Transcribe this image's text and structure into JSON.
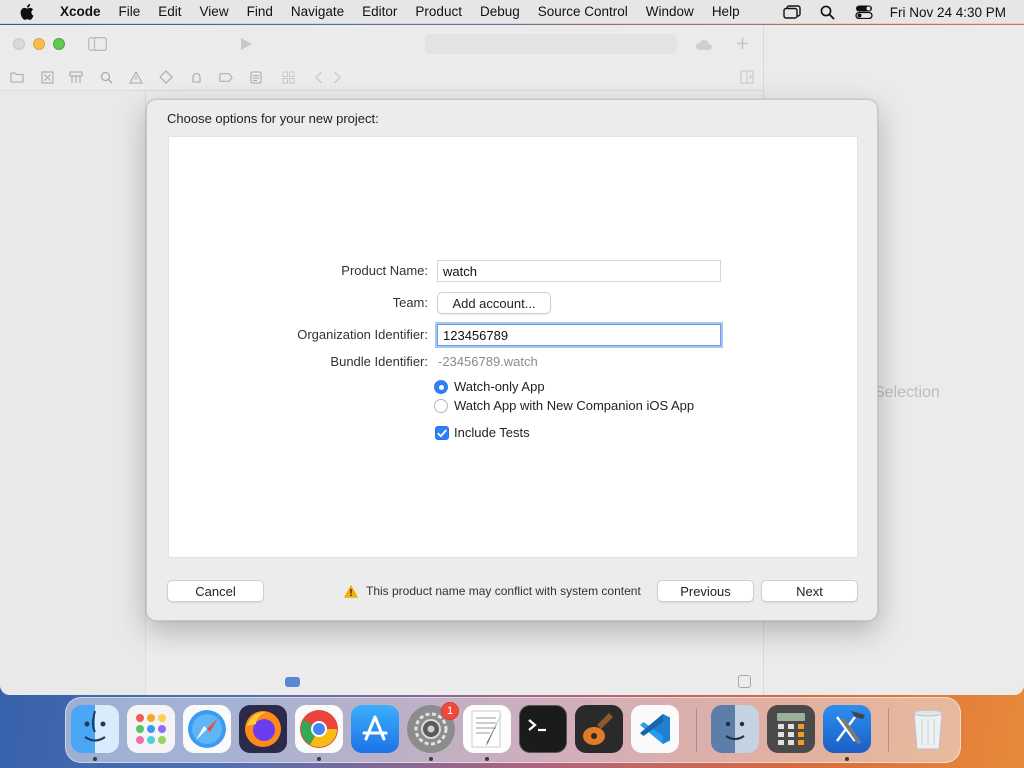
{
  "menubar": {
    "app_name": "Xcode",
    "items": [
      "File",
      "Edit",
      "View",
      "Find",
      "Navigate",
      "Editor",
      "Product",
      "Debug",
      "Source Control",
      "Window",
      "Help"
    ],
    "clock": "Fri Nov 24  4:30 PM"
  },
  "window": {
    "inspector_placeholder": "Selection"
  },
  "dialog": {
    "title": "Choose options for your new project:",
    "product_name": {
      "label": "Product Name:",
      "value": "watch"
    },
    "team": {
      "label": "Team:",
      "button": "Add account..."
    },
    "org_id": {
      "label": "Organization Identifier:",
      "value": "123456789"
    },
    "bundle_id": {
      "label": "Bundle Identifier:",
      "value": "-23456789.watch"
    },
    "app_options": [
      {
        "label": "Watch-only App",
        "selected": true
      },
      {
        "label": "Watch App with New Companion iOS App",
        "selected": false
      }
    ],
    "include_tests": {
      "label": "Include Tests",
      "checked": true
    },
    "warning": "This product name may conflict with system content",
    "buttons": {
      "cancel": "Cancel",
      "previous": "Previous",
      "next": "Next"
    }
  },
  "dock": {
    "apps": [
      "finder-icon",
      "launchpad-icon",
      "safari-icon",
      "firefox-icon",
      "chrome-icon",
      "app-store-icon",
      "system-settings-icon",
      "textedit-icon",
      "terminal-icon",
      "garageband-icon",
      "vscode-icon",
      "finder-alt-icon",
      "calculator-icon",
      "xcode-icon",
      "trash-icon"
    ],
    "settings_badge": "1"
  },
  "colors": {
    "accent": "#2f7ff6",
    "warning": "#f5b300"
  }
}
